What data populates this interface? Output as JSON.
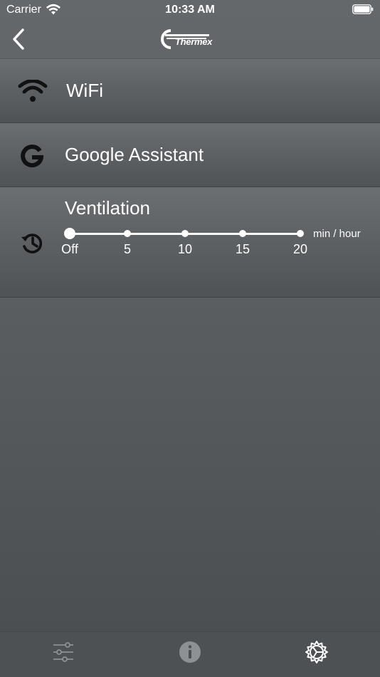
{
  "status_bar": {
    "carrier": "Carrier",
    "time": "10:33 AM"
  },
  "nav": {
    "back_icon": "chevron-left-icon",
    "logo_text": "Thermex"
  },
  "rows": {
    "wifi": {
      "label": "WiFi",
      "icon": "wifi-icon"
    },
    "google": {
      "label": "Google Assistant",
      "icon": "google-g-icon"
    },
    "ventilation": {
      "label": "Ventilation",
      "icon": "history-icon",
      "unit": "min / hour",
      "options": [
        "Off",
        "5",
        "10",
        "15",
        "20"
      ],
      "selected": "Off"
    }
  },
  "tabs": [
    {
      "name": "sliders",
      "icon": "sliders-icon",
      "active": false
    },
    {
      "name": "info",
      "icon": "info-icon",
      "active": false
    },
    {
      "name": "settings",
      "icon": "gear-icon",
      "active": true
    }
  ],
  "colors": {
    "background": "#5b5f62",
    "row_top": "#6b6f72",
    "tab_bar": "#4e5154",
    "inactive_icon": "#8e9194",
    "active_icon": "#ffffff"
  }
}
